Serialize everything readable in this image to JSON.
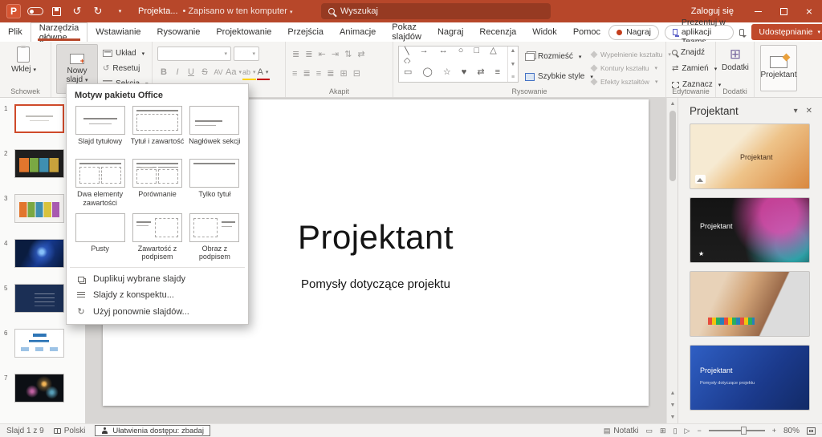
{
  "titlebar": {
    "app_initial": "P",
    "doc_title": "Projekta...",
    "doc_status": "Zapisano w ten komputer",
    "search_placeholder": "Wyszukaj",
    "signin_label": "Zaloguj się"
  },
  "tabs": {
    "items": [
      {
        "label": "Plik"
      },
      {
        "label": "Narzędzia główne"
      },
      {
        "label": "Wstawianie"
      },
      {
        "label": "Rysowanie"
      },
      {
        "label": "Projektowanie"
      },
      {
        "label": "Przejścia"
      },
      {
        "label": "Animacje"
      },
      {
        "label": "Pokaz slajdów"
      },
      {
        "label": "Nagraj"
      },
      {
        "label": "Recenzja"
      },
      {
        "label": "Widok"
      },
      {
        "label": "Pomoc"
      }
    ],
    "record_button": "Nagraj",
    "teams_button": "Prezentuj w aplikacji Teams",
    "share_button": "Udostępnianie"
  },
  "ribbon": {
    "paste": "Wklej",
    "group_clipboard": "Schowek",
    "new_slide": "Nowy slajd",
    "layout": "Układ",
    "reset": "Resetuj",
    "section": "Sekcja",
    "group_paragraph": "Akapit",
    "group_drawing": "Rysowanie",
    "arrange": "Rozmieść",
    "quick_styles": "Szybkie style",
    "shape_fill": "Wypełnienie kształtu",
    "shape_outline": "Kontury kształtu",
    "shape_effects": "Efekty kształtów",
    "find": "Znajdź",
    "replace": "Zamień",
    "select": "Zaznacz",
    "group_editing": "Edytowanie",
    "addins": "Dodatki",
    "group_addins": "Dodatki",
    "designer": "Projektant",
    "font": {
      "bold": "B",
      "italic": "I",
      "underline": "U",
      "strike": "S",
      "spacing": "AV",
      "case": "Aa",
      "color": "A",
      "highlight": "ab"
    }
  },
  "layout_menu": {
    "title": "Motyw pakietu Office",
    "layouts": [
      "Slajd tytułowy",
      "Tytuł i zawartość",
      "Nagłówek sekcji",
      "Dwa elementy zawartości",
      "Porównanie",
      "Tylko tytuł",
      "Pusty",
      "Zawartość z podpisem",
      "Obraz z podpisem"
    ],
    "actions": [
      "Duplikuj wybrane slajdy",
      "Slajdy z konspektu...",
      "Użyj ponownie slajdów..."
    ]
  },
  "slides_panel": {
    "numbers": [
      "1",
      "2",
      "3",
      "4",
      "5",
      "6",
      "7"
    ]
  },
  "slide": {
    "title": "Projektant",
    "subtitle": "Pomysły dotyczące projektu"
  },
  "designer": {
    "title": "Projektant",
    "cards": [
      {
        "label": "Projektant"
      },
      {
        "label": "Projektant"
      },
      {
        "label": ""
      },
      {
        "label": "Projektant",
        "sublabel": "Pomysły dotyczące projektu"
      }
    ]
  },
  "statusbar": {
    "slide_info": "Slajd 1 z 9",
    "language": "Polski",
    "accessibility": "Ułatwienia dostępu: zbadaj",
    "notes": "Notatki",
    "zoom": "80%"
  }
}
